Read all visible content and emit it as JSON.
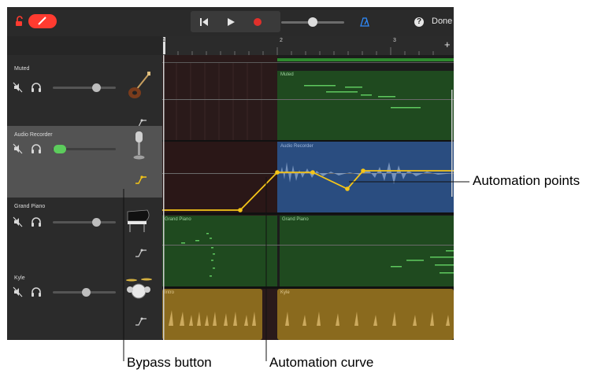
{
  "toolbar": {
    "done_label": "Done",
    "help_label": "?"
  },
  "ruler": {
    "bars": [
      "1",
      "2",
      "3"
    ],
    "add_label": "+"
  },
  "tracks": [
    {
      "name": "Muted",
      "instrument": "electric-guitar"
    },
    {
      "name": "Audio Recorder",
      "instrument": "microphone",
      "selected": true
    },
    {
      "name": "Grand Piano",
      "instrument": "grand-piano"
    },
    {
      "name": "Kyle",
      "instrument": "drum-kit"
    }
  ],
  "regions": {
    "muted": "Muted",
    "audio_recorder": "Audio Recorder",
    "grand_piano_1": "Grand Piano",
    "grand_piano_2": "Grand Piano",
    "intro": "Intro",
    "kyle": "Kyle"
  },
  "callouts": {
    "automation_points": "Automation points",
    "bypass_button": "Bypass button",
    "automation_curve": "Automation curve"
  },
  "colors": {
    "edit_button": "#ff3b30",
    "automation": "#f5c518",
    "midi_region": "#1f4a1f",
    "audio_region": "#2a4d80",
    "drummer_region": "#8a6a1e"
  }
}
